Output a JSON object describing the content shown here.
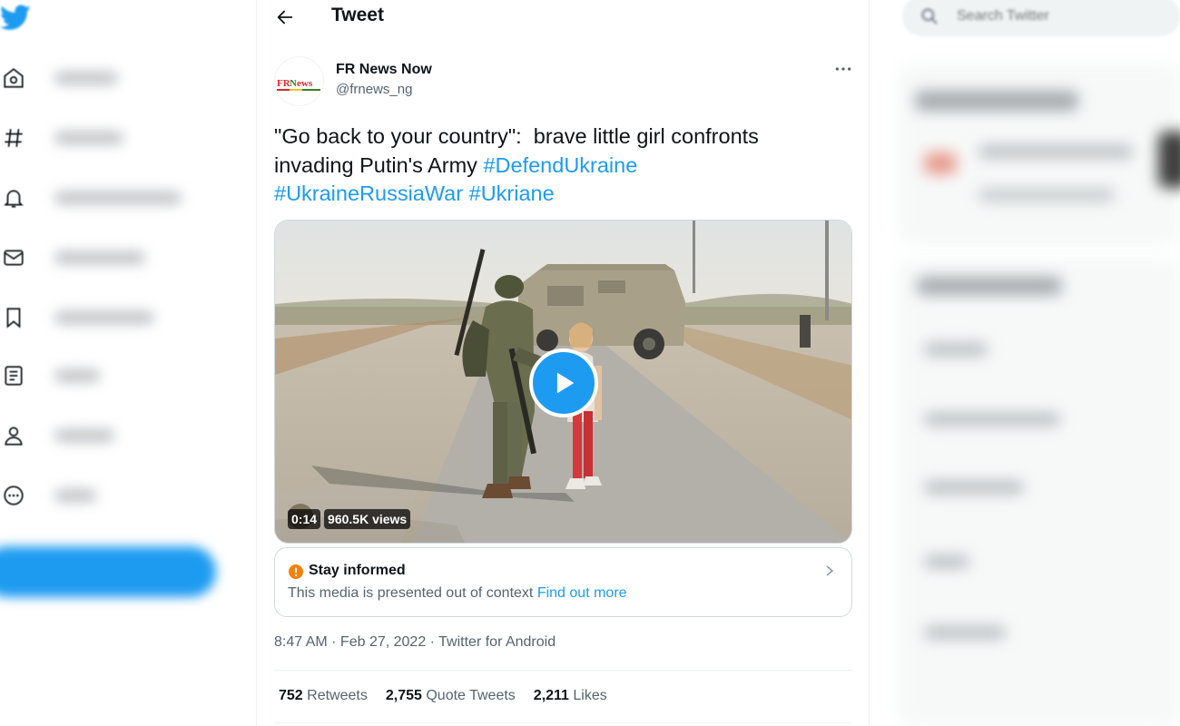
{
  "left_nav": {
    "items": [
      {
        "icon": "home-icon"
      },
      {
        "icon": "hashtag-icon"
      },
      {
        "icon": "bell-icon"
      },
      {
        "icon": "envelope-icon"
      },
      {
        "icon": "bookmark-icon"
      },
      {
        "icon": "list-icon"
      },
      {
        "icon": "profile-icon"
      },
      {
        "icon": "more-circle-icon"
      }
    ],
    "brand_icon": "twitter-bird-icon"
  },
  "header": {
    "title": "Tweet",
    "back_icon": "arrow-left-icon"
  },
  "tweet": {
    "author": {
      "name": "FR News Now",
      "handle": "@frnews_ng",
      "avatar_logo": "FRNews"
    },
    "text": {
      "line1": "\"Go back to your country\":  brave little girl confronts",
      "line2_prefix": "invading Putin's Army ",
      "hashtag1": "#DefendUkraine",
      "hashtag2": "#UkraineRussiaWar",
      "hashtag3": "#Ukriane"
    },
    "media": {
      "duration": "0:14",
      "views": "960.5K views"
    },
    "notice": {
      "title": "Stay informed",
      "description": "This media is presented out of context",
      "link": "Find out more"
    },
    "meta": {
      "time": "8:47 AM",
      "separator": " · ",
      "date": "Feb 27, 2022",
      "source": "Twitter for Android"
    },
    "stats": {
      "retweets_count": "752",
      "retweets_label": "Retweets",
      "quotes_count": "2,755",
      "quotes_label": "Quote Tweets",
      "likes_count": "2,211",
      "likes_label": "Likes"
    }
  },
  "right_sidebar": {
    "search_placeholder": "Search Twitter"
  },
  "colors": {
    "accent": "#1d9bf0",
    "text_primary": "#0f1419",
    "text_secondary": "#536471",
    "border": "#cfd9de",
    "warning": "#f4800b"
  }
}
